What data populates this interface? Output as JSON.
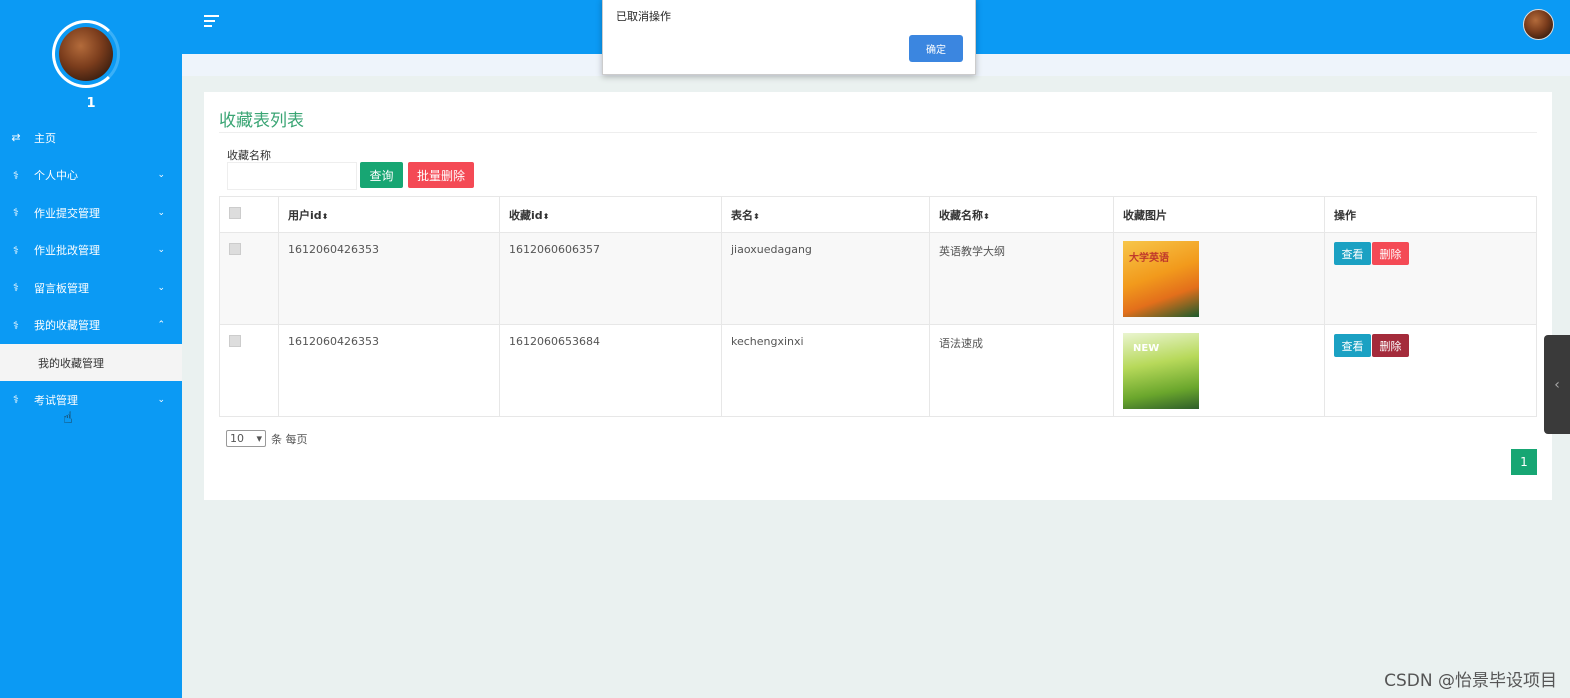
{
  "sidebar": {
    "user_name": "1",
    "items": [
      {
        "label": "主页",
        "icon": "swap-icon",
        "chevron": ""
      },
      {
        "label": "个人中心",
        "icon": "stethoscope-icon",
        "chevron": "⌄"
      },
      {
        "label": "作业提交管理",
        "icon": "stethoscope-icon",
        "chevron": "⌄"
      },
      {
        "label": "作业批改管理",
        "icon": "stethoscope-icon",
        "chevron": "⌄"
      },
      {
        "label": "留言板管理",
        "icon": "stethoscope-icon",
        "chevron": "⌄"
      },
      {
        "label": "我的收藏管理",
        "icon": "stethoscope-icon",
        "chevron": "⌃"
      }
    ],
    "submenu_label": "我的收藏管理",
    "last_item": {
      "label": "考试管理",
      "icon": "stethoscope-icon",
      "chevron": "⌄"
    }
  },
  "panel": {
    "title": "收藏表列表",
    "search_label": "收藏名称",
    "search_placeholder": "",
    "search_button": "查询",
    "batch_delete_button": "批量删除"
  },
  "table": {
    "headers": [
      "用户id",
      "收藏id",
      "表名",
      "收藏名称",
      "收藏图片",
      "操作"
    ],
    "sortable_marker": "⬍",
    "rows": [
      {
        "user_id": "1612060426353",
        "fav_id": "1612060606357",
        "table_name": "jiaoxuedagang",
        "fav_name": "英语教学大纲",
        "image_text": "大学英语",
        "view": "查看",
        "delete": "删除"
      },
      {
        "user_id": "1612060426353",
        "fav_id": "1612060653684",
        "table_name": "kechengxinxi",
        "fav_name": "语法速成",
        "image_text": "NEW",
        "view": "查看",
        "delete": "删除"
      }
    ]
  },
  "pagination": {
    "page_size": "10",
    "page_size_suffix": "条 每页",
    "current_page": "1"
  },
  "alert": {
    "message": "已取消操作",
    "ok_label": "确定"
  },
  "watermark": "CSDN @怡景毕设项目",
  "colors": {
    "primary": "#0b9af4",
    "accent_green": "#17a673",
    "danger": "#f44a55"
  }
}
